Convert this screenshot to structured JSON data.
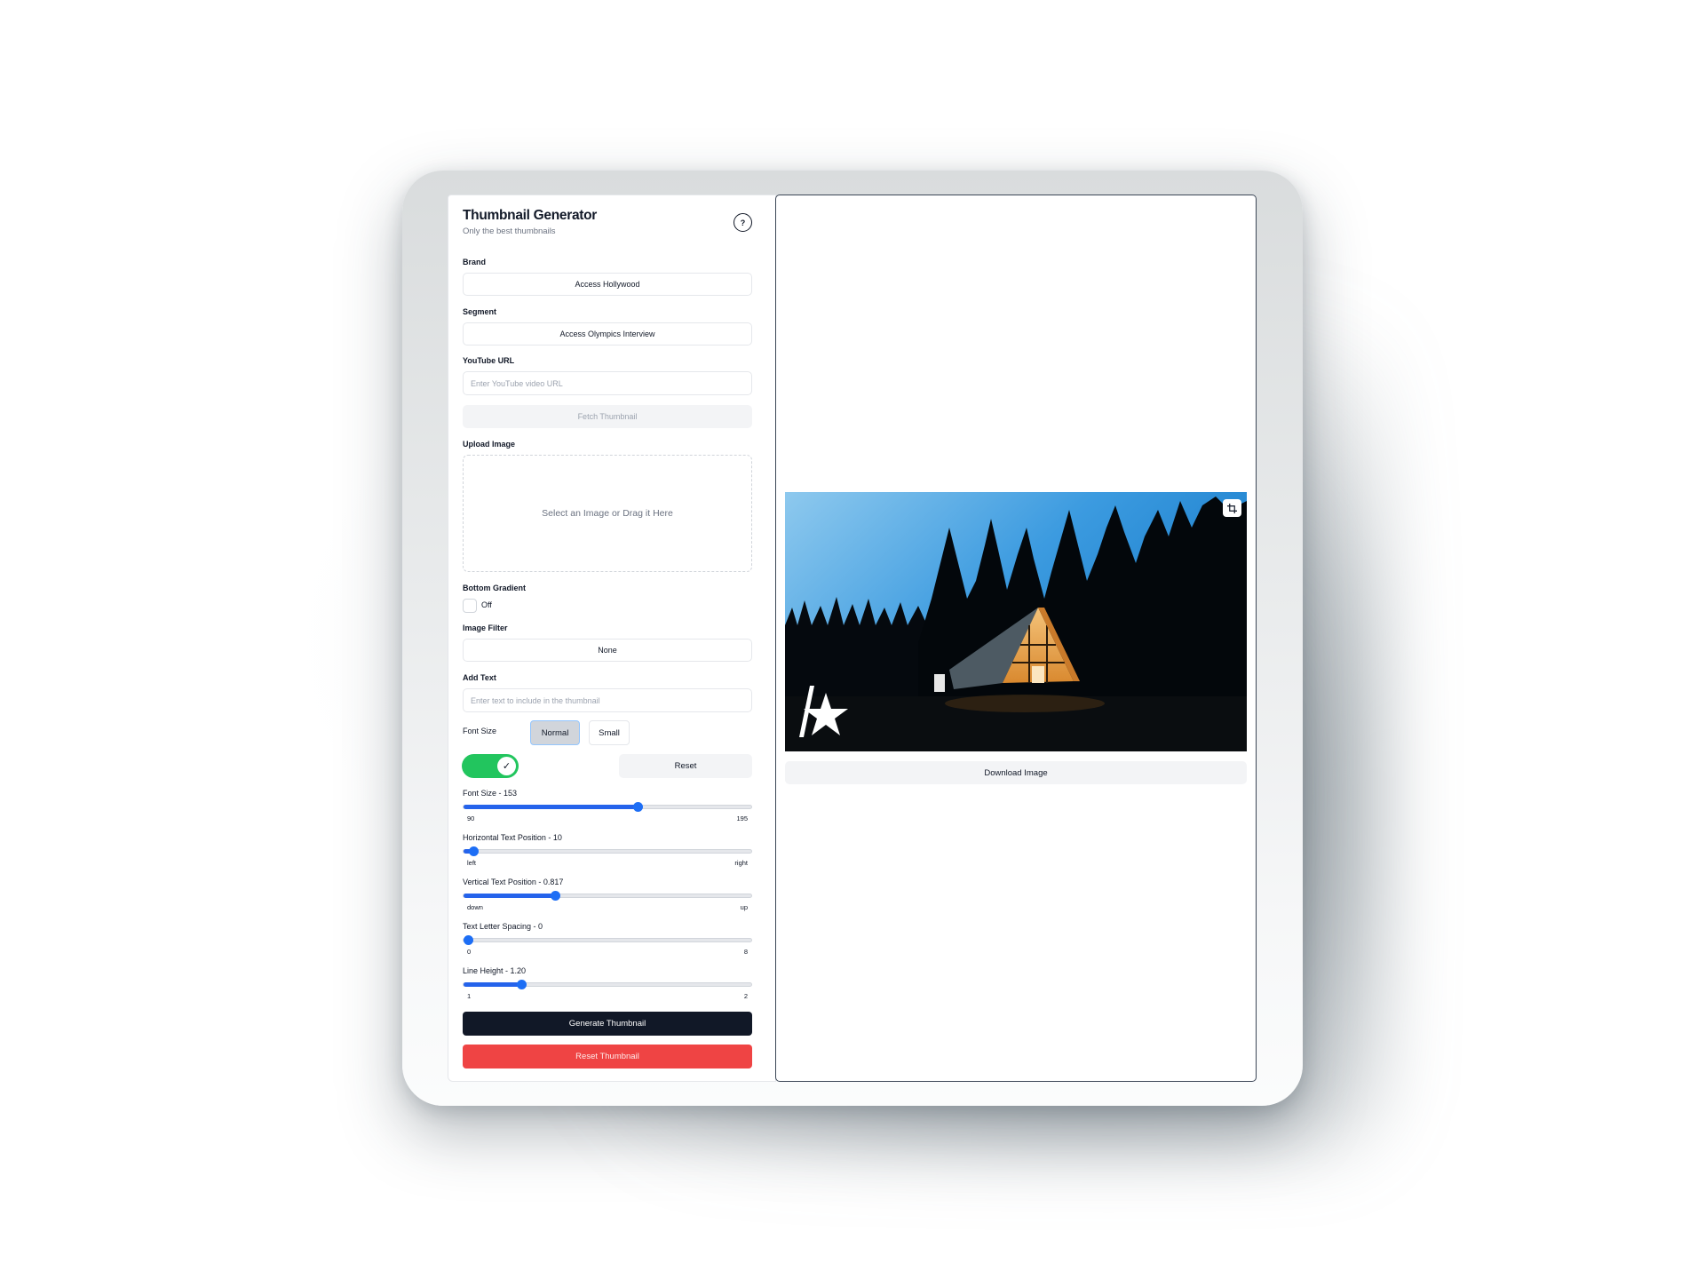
{
  "app": {
    "title": "Thumbnail Generator",
    "subtitle": "Only the best thumbnails",
    "help_label": "?"
  },
  "form": {
    "brand": {
      "label": "Brand",
      "value": "Access Hollywood"
    },
    "segment": {
      "label": "Segment",
      "value": "Access Olympics Interview"
    },
    "youtube_url": {
      "label": "YouTube URL",
      "value": "",
      "placeholder": "Enter YouTube video URL"
    },
    "fetch_button": "Fetch Thumbnail",
    "upload": {
      "label": "Upload Image",
      "prompt": "Select an Image or Drag it Here"
    },
    "bottom_gradient": {
      "label": "Bottom Gradient",
      "checked": false,
      "state_label": "Off"
    },
    "image_filter": {
      "label": "Image Filter",
      "value": "None"
    },
    "add_text": {
      "label": "Add Text",
      "value": "",
      "placeholder": "Enter text to include in the thumbnail"
    },
    "font_size_mode": {
      "label": "Font Size",
      "options": [
        "Normal",
        "Small"
      ],
      "selected": "Normal"
    },
    "toggle": {
      "on": true,
      "check_glyph": "✓"
    },
    "reset_button": "Reset",
    "sliders": [
      {
        "label": "Font Size - 153",
        "value": 153,
        "min": 90,
        "max": 195,
        "min_label": "90",
        "max_label": "195"
      },
      {
        "label": "Horizontal Text Position - 10",
        "value": 10,
        "min": 0,
        "max": 300,
        "min_label": "left",
        "max_label": "right"
      },
      {
        "label": "Vertical Text Position - 0.817",
        "value": 0.817,
        "min": 0.5,
        "max": 1.5,
        "min_label": "down",
        "max_label": "up"
      },
      {
        "label": "Text Letter Spacing - 0",
        "value": 0,
        "min": 0,
        "max": 8,
        "min_label": "0",
        "max_label": "8"
      },
      {
        "label": "Line Height - 1.20",
        "value": 1.2,
        "min": 1,
        "max": 2,
        "min_label": "1",
        "max_label": "2"
      }
    ],
    "generate_button": "Generate Thumbnail",
    "reset_thumbnail_button": "Reset Thumbnail"
  },
  "preview": {
    "image_description": "A-frame cabin lit at dusk in pine forest",
    "logo_icon": "slash-star-logo",
    "crop_icon": "crop-icon",
    "download_button": "Download Image"
  },
  "colors": {
    "accent_blue": "#1d6ef5",
    "toggle_green": "#22c55e",
    "primary_dark": "#111827",
    "danger_red": "#ef4444"
  }
}
